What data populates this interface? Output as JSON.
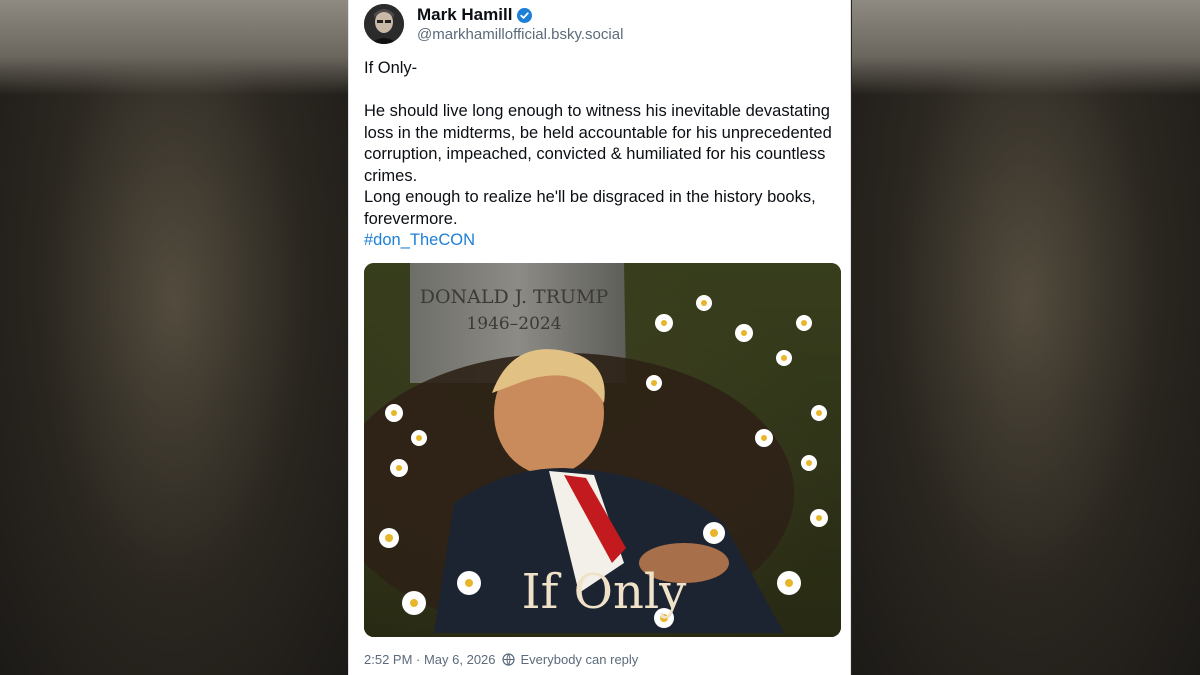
{
  "post": {
    "author_name": "Mark Hamill",
    "handle": "@markhamillofficial.bsky.social",
    "text_line1": "If Only-",
    "text_para2": "He should live long enough to witness his inevitable devastating loss in the midterms, be held accountable for his unprecedented corruption, impeached, convicted & humiliated for his countless crimes.",
    "text_para3": "Long enough to realize he'll be disgraced in the history books, forevermore.",
    "hashtag": "#don_TheCON",
    "image": {
      "headstone_name": "DONALD J. TRUMP",
      "headstone_years": "1946–2024",
      "caption": "If Only"
    },
    "timestamp": "2:52 PM · May 6, 2026",
    "reply_setting": "Everybody can reply"
  },
  "icons": {
    "verified": "verified-badge-icon",
    "reply_setting": "globe-icon"
  },
  "colors": {
    "accent": "#1d7fd6",
    "text": "#0b0f14",
    "muted": "#5b6b7b"
  }
}
